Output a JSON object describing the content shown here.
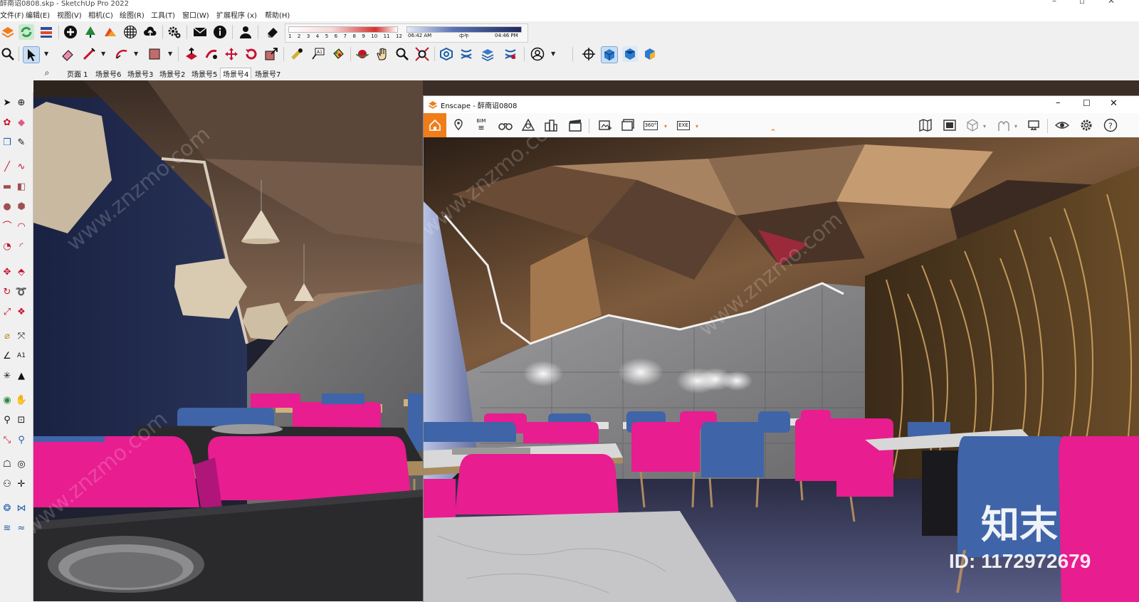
{
  "window": {
    "title": "醉南诏0808.skp - SketchUp Pro 2022"
  },
  "menu": [
    "文件(F)",
    "编辑(E)",
    "视图(V)",
    "相机(C)",
    "绘图(R)",
    "工具(T)",
    "窗口(W)",
    "扩展程序 (x)",
    "帮助(H)"
  ],
  "shadow": {
    "months": [
      "1",
      "2",
      "3",
      "4",
      "5",
      "6",
      "7",
      "8",
      "9",
      "10",
      "11",
      "12"
    ],
    "time_start": "06:42 AM",
    "time_mid": "中午",
    "time_end": "04:46 PM"
  },
  "scenes": {
    "items": [
      "页面 1",
      "场景号6",
      "场景号3",
      "场景号2",
      "场景号5",
      "场景号4",
      "场景号7"
    ],
    "active_index": 5
  },
  "enscape": {
    "title": "Enscape - 醉南诏0808",
    "accent": "#f07d1a",
    "bim_label": "BIM",
    "pano_label": "360°",
    "exe_label": "EXE"
  },
  "watermark": {
    "brand": "知末",
    "id": "ID: 1172972679",
    "diagonal": "www.znzmo.com"
  },
  "colors": {
    "chair_pink": "#e81d8f",
    "chair_blue": "#3f64a8",
    "ceiling_brown": "#6b5444",
    "wall_navy": "#1e2848"
  }
}
